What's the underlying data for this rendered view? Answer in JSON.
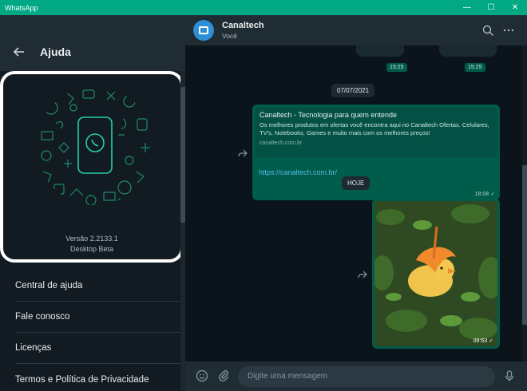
{
  "window": {
    "title": "WhatsApp",
    "controls": [
      "—",
      "☐",
      "✕"
    ]
  },
  "help": {
    "title": "Ajuda",
    "version": "Versão 2.2133.1",
    "edition": "Desktop Beta",
    "menu": [
      "Central de ajuda",
      "Fale conosco",
      "Licenças",
      "Termos e Política de Privacidade"
    ]
  },
  "chat": {
    "name": "Canaltech",
    "subtitle": "Você",
    "times_top": [
      "15:25",
      "15:25"
    ],
    "date_chip": "07/07/2021",
    "today_chip": "HOJE",
    "link_message": {
      "title": "Canaltech - Tecnologia para quem entende",
      "description": "Os melhores produtos em ofertas você encontra aqui no Canaltech Ofertas. Celulares, TV's, Notebooks, Games e muito mais com os melhores preços!",
      "domain": "canaltech.com.br",
      "url": "https://canaltech.com.br/",
      "time": "18:08"
    },
    "photo_message": {
      "time": "09:53"
    },
    "composer_placeholder": "Digite uma mensagem"
  },
  "colors": {
    "accent": "#00a884",
    "outgoing": "#005c4b",
    "background": "#0b141a"
  }
}
